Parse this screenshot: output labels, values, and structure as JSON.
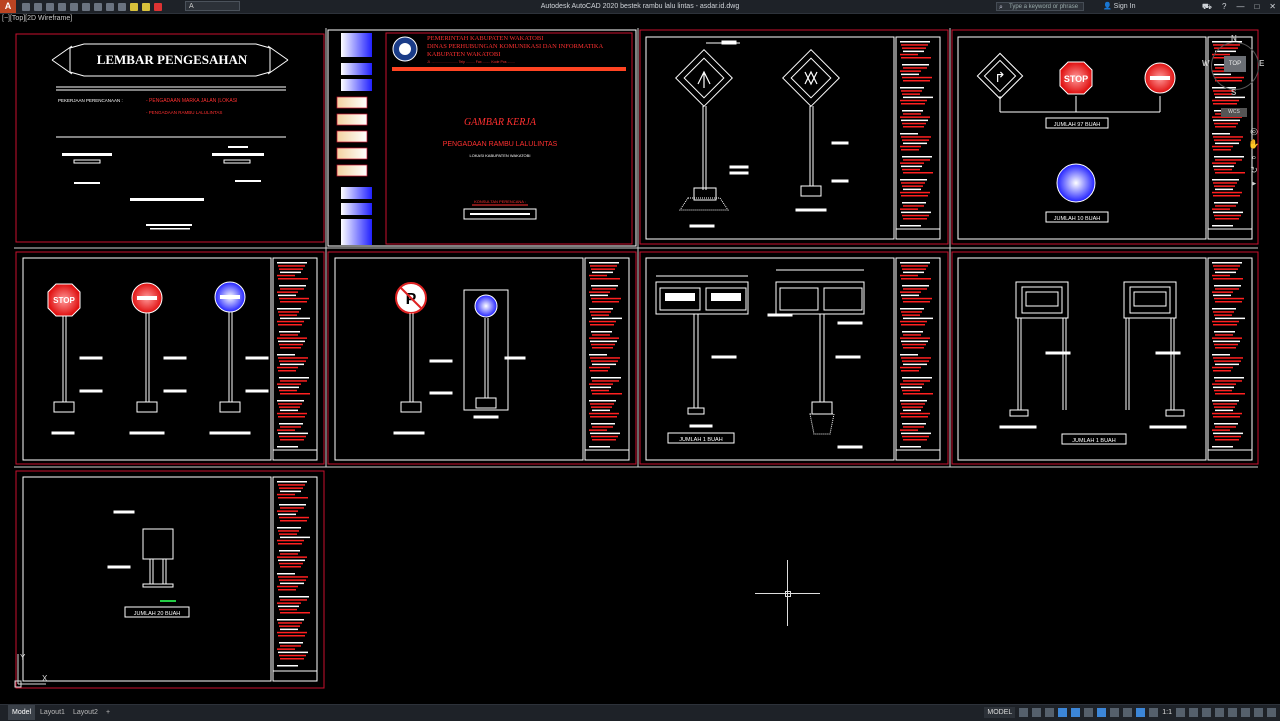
{
  "app": {
    "logo_letter": "A",
    "window_title": "Autodesk AutoCAD 2020   bestek rambu lalu lintas - asdar.id.dwg",
    "layer": "A",
    "search_placeholder": "Type a keyword or phrase",
    "sign_in": "Sign In",
    "viewport_label": "[−][Top][2D Wireframe]"
  },
  "viewcube": {
    "north": "N",
    "south": "S",
    "west": "W",
    "east": "E",
    "top_face": "TOP",
    "wcs": "WCS"
  },
  "sheets": {
    "approval": {
      "title": "LEMBAR PENGESAHAN",
      "work_label": "PEKERJAAN PERENCANAAN :",
      "work_line1": "- PENGADAAN MARKA JALAN (LOKASI",
      "work_line2": "- PENGADAAN RAMBU LALULINTAS"
    },
    "cover": {
      "gov1": "PEMERINTAH KABUPATEN WAKATOBI",
      "gov2": "DINAS PERHUBUNGAN KOMUNIKASI DAN INFORMATIKA",
      "gov3": "KABUPATEN WAKATOBI",
      "address": "Jl. ........................... Telp .........  Fax ........  Kode Pos ........",
      "main_title": "GAMBAR KERJA",
      "sub_title": "PENGADAAN RAMBU LALULINTAS",
      "location": "LOKASI KABUPATEN WAKATOBI",
      "consultant": "KONSULTAN PERENCANA :"
    },
    "totals": {
      "t97": "JUMLAH 97 BUAH",
      "t10": "JUMLAH 10 BUAH",
      "t1a": "JUMLAH 1 BUAH",
      "t1b": "JUMLAH 1 BUAH",
      "t20": "JUMLAH 20 BUAH"
    },
    "sign_text": {
      "stop": "STOP",
      "turn": "↱"
    }
  },
  "status": {
    "tab_model": "Model",
    "tab_layout1": "Layout1",
    "tab_layout2": "Layout2",
    "tab_add": "+",
    "model_label": "MODEL",
    "scale": "1:1"
  },
  "colors": {
    "frame": "#c8102e",
    "accent_red": "#ff2020",
    "white": "#ffffff",
    "blue_sign": "#1a1aff"
  }
}
